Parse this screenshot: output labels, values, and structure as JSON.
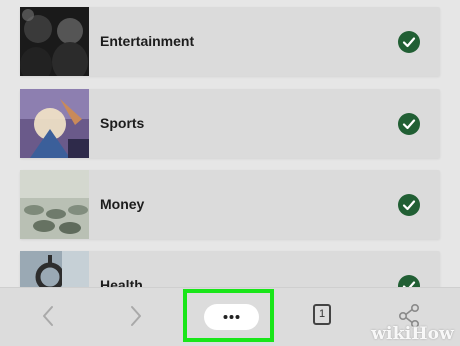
{
  "categories": [
    {
      "label": "Entertainment",
      "checked": true,
      "thumbnail": "concert-crowd-photo"
    },
    {
      "label": "Sports",
      "checked": true,
      "thumbnail": "sports-action-photo"
    },
    {
      "label": "Money",
      "checked": true,
      "thumbnail": "coins-photo"
    },
    {
      "label": "Health",
      "checked": true,
      "thumbnail": "stethoscope-photo"
    }
  ],
  "toolbar": {
    "back_icon": "chevron-left-icon",
    "forward_icon": "chevron-right-icon",
    "more_icon": "ellipsis-icon",
    "tabs_count": "1",
    "share_icon": "share-icon",
    "highlight_color": "#19e619"
  },
  "colors": {
    "check_green": "#215f34",
    "background": "#e6e6e6",
    "card": "#dbdbdb"
  },
  "watermark": {
    "wiki": "wiki",
    "how": "How"
  }
}
